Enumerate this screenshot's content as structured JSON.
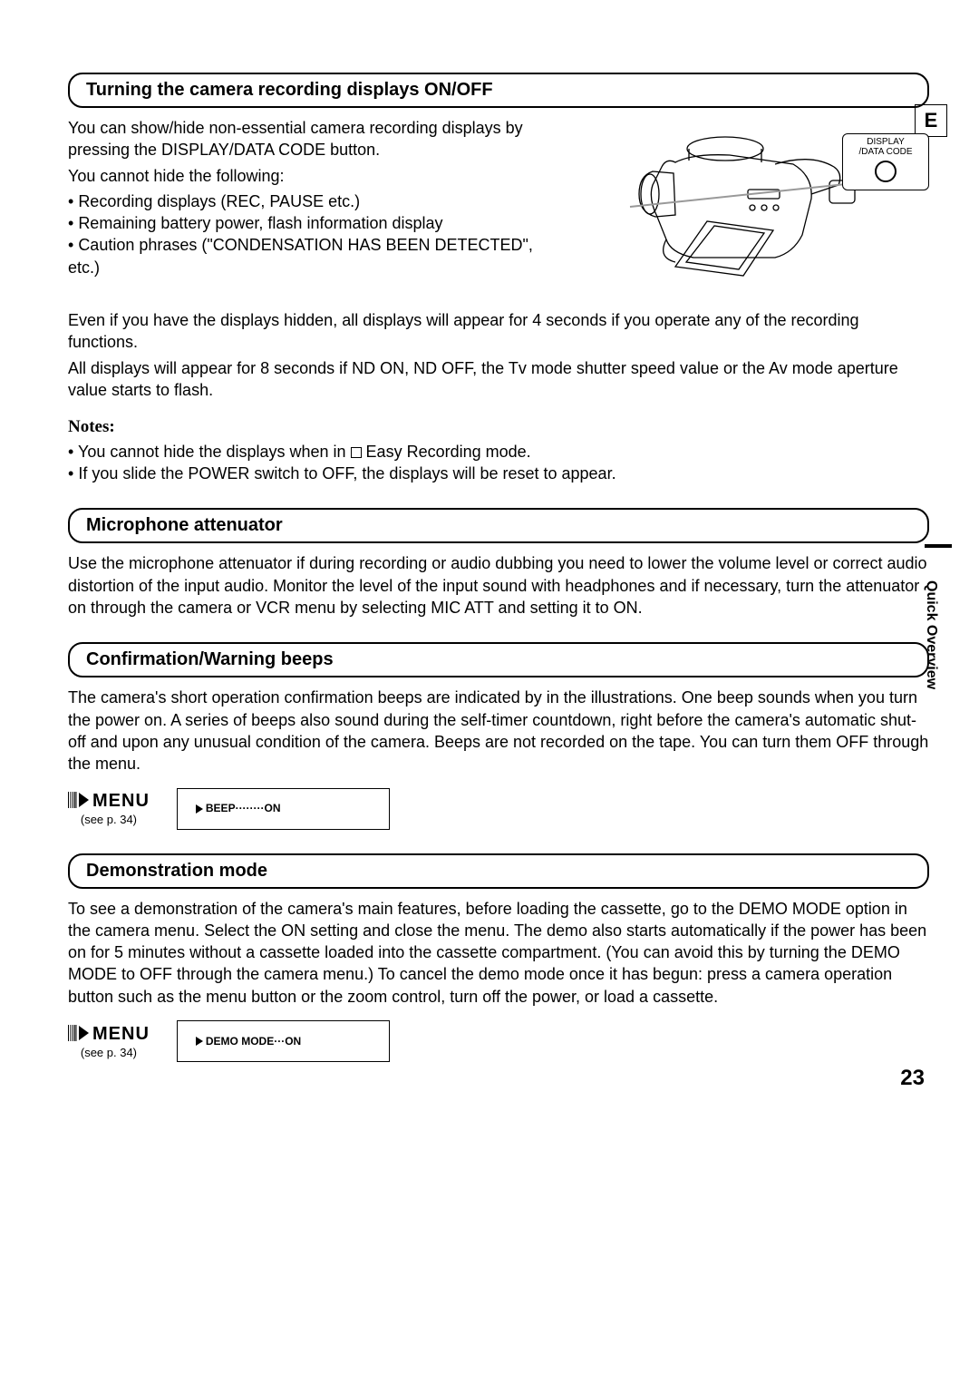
{
  "page_tab": "E",
  "side_text": "Quick Overview",
  "page_number": "23",
  "section1": {
    "title": "Turning the camera recording displays ON/OFF",
    "p1": "You can show/hide non-essential camera recording displays by pressing the DISPLAY/DATA CODE button.",
    "p2": "You cannot hide the following:",
    "b1": "Recording displays (REC, PAUSE etc.)",
    "b2": "Remaining battery power, flash information display",
    "b3": "Caution phrases (\"CONDENSATION HAS BEEN DETECTED\", etc.)",
    "callout_line1": "DISPLAY",
    "callout_line2": "/DATA CODE",
    "p3": "Even if you have the displays hidden, all displays will appear for 4 seconds if you operate any of the recording functions.",
    "p4": "All displays will appear for 8 seconds if ND ON, ND OFF, the Tv mode shutter speed value or the Av mode aperture value starts to flash.",
    "notes_label": "Notes:",
    "note1a": "You cannot hide the displays when in ",
    "note1b": " Easy Recording mode.",
    "note2": "If you slide the POWER switch to OFF, the displays will be reset to appear."
  },
  "section2": {
    "title": "Microphone attenuator",
    "p1": "Use the microphone attenuator if during recording or audio dubbing you need to lower the volume level or correct audio distortion of the input audio. Monitor the level of the input sound with headphones and if necessary, turn the attenuator on through the camera or VCR menu by selecting MIC ATT and setting it to ON."
  },
  "section3": {
    "title": "Confirmation/Warning beeps",
    "p1": "The camera's short operation confirmation beeps are indicated by in the illustrations. One beep sounds when you turn the power on. A series of beeps also sound during the self-timer countdown, right before the camera's automatic shut-off and upon any unusual condition of the camera. Beeps are not recorded on the tape. You can turn them OFF through the menu.",
    "menu_word": "MENU",
    "see": "(see p. 34)",
    "lcd": "BEEP········ON"
  },
  "section4": {
    "title": "Demonstration mode",
    "p1": "To see a demonstration of the camera's main features, before loading the cassette, go to the DEMO MODE option in the camera menu. Select the ON setting and close the menu. The demo also starts automatically if the power has been on for 5 minutes without a cassette loaded into the cassette compartment. (You can avoid this by turning the DEMO MODE to OFF through the camera menu.) To cancel the demo mode once it has begun: press a camera operation button such as the menu button or the zoom control, turn off the power, or load a cassette.",
    "menu_word": "MENU",
    "see": "(see p. 34)",
    "lcd": "DEMO MODE···ON"
  }
}
